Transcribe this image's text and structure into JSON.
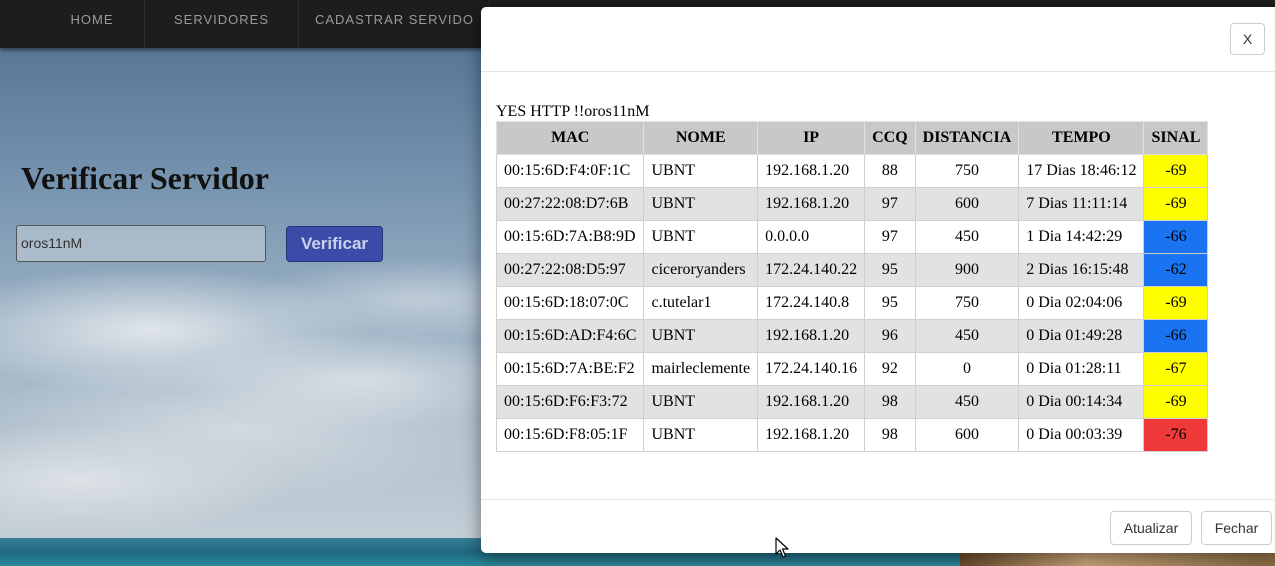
{
  "nav": {
    "home": "HOME",
    "servers": "SERVIDORES",
    "register": "CADASTRAR SERVIDO"
  },
  "page": {
    "title": "Verificar Servidor",
    "input_value": "oros11nM",
    "verify_label": "Verificar"
  },
  "modal": {
    "close_x": "X",
    "result_line": "YES HTTP !!oros11nM",
    "columns": [
      "MAC",
      "NOME",
      "IP",
      "CCQ",
      "DISTANCIA",
      "TEMPO",
      "SINAL"
    ],
    "rows": [
      {
        "mac": "00:15:6D:F4:0F:1C",
        "nome": "UBNT",
        "ip": "192.168.1.20",
        "ccq": "88",
        "dist": "750",
        "tempo": "17 Dias 18:46:12",
        "sinal": "-69",
        "color": "#ffff00"
      },
      {
        "mac": "00:27:22:08:D7:6B",
        "nome": "UBNT",
        "ip": "192.168.1.20",
        "ccq": "97",
        "dist": "600",
        "tempo": "7 Dias 11:11:14",
        "sinal": "-69",
        "color": "#ffff00"
      },
      {
        "mac": "00:15:6D:7A:B8:9D",
        "nome": "UBNT",
        "ip": "0.0.0.0",
        "ccq": "97",
        "dist": "450",
        "tempo": "1 Dia 14:42:29",
        "sinal": "-66",
        "color": "#1a73f0"
      },
      {
        "mac": "00:27:22:08:D5:97",
        "nome": "ciceroryanders",
        "ip": "172.24.140.22",
        "ccq": "95",
        "dist": "900",
        "tempo": "2 Dias 16:15:48",
        "sinal": "-62",
        "color": "#1a73f0"
      },
      {
        "mac": "00:15:6D:18:07:0C",
        "nome": "c.tutelar1",
        "ip": "172.24.140.8",
        "ccq": "95",
        "dist": "750",
        "tempo": "0 Dia 02:04:06",
        "sinal": "-69",
        "color": "#ffff00"
      },
      {
        "mac": "00:15:6D:AD:F4:6C",
        "nome": "UBNT",
        "ip": "192.168.1.20",
        "ccq": "96",
        "dist": "450",
        "tempo": "0 Dia 01:49:28",
        "sinal": "-66",
        "color": "#1a73f0"
      },
      {
        "mac": "00:15:6D:7A:BE:F2",
        "nome": "mairleclemente",
        "ip": "172.24.140.16",
        "ccq": "92",
        "dist": "0",
        "tempo": "0 Dia 01:28:11",
        "sinal": "-67",
        "color": "#ffff00"
      },
      {
        "mac": "00:15:6D:F6:F3:72",
        "nome": "UBNT",
        "ip": "192.168.1.20",
        "ccq": "98",
        "dist": "450",
        "tempo": "0 Dia 00:14:34",
        "sinal": "-69",
        "color": "#ffff00"
      },
      {
        "mac": "00:15:6D:F8:05:1F",
        "nome": "UBNT",
        "ip": "192.168.1.20",
        "ccq": "98",
        "dist": "600",
        "tempo": "0 Dia 00:03:39",
        "sinal": "-76",
        "color": "#f03a3a"
      }
    ],
    "update_label": "Atualizar",
    "close_label": "Fechar"
  }
}
